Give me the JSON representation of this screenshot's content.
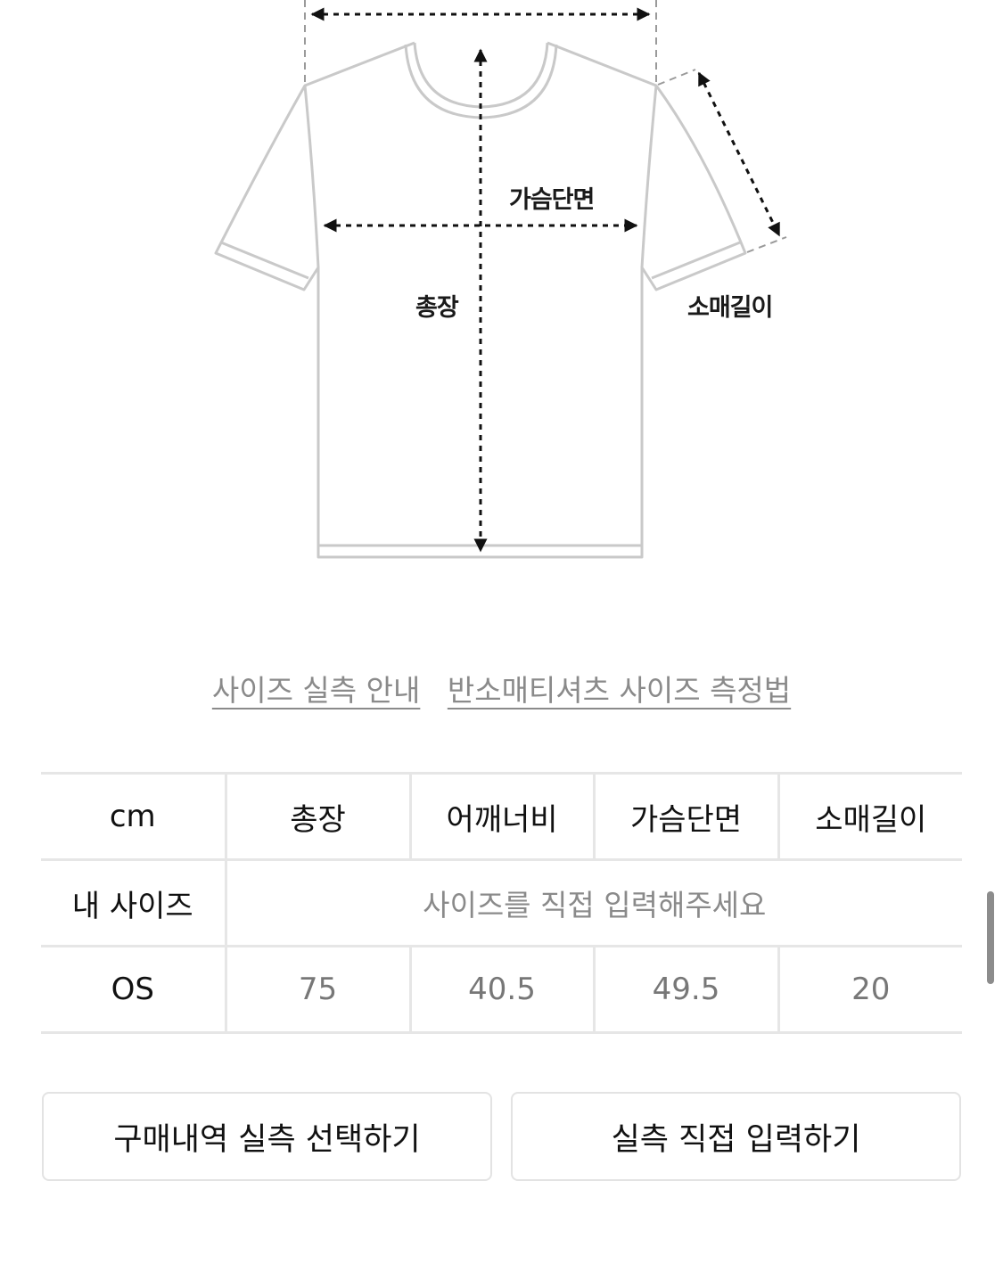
{
  "diagram": {
    "labels": {
      "chest": "가슴단면",
      "length": "총장",
      "sleeve": "소매길이"
    }
  },
  "links": {
    "size_guide": "사이즈 실측 안내",
    "measure_method": "반소매티셔츠 사이즈 측정법"
  },
  "table": {
    "unit": "cm",
    "columns": [
      "총장",
      "어깨너비",
      "가슴단면",
      "소매길이"
    ],
    "my_size_label": "내 사이즈",
    "my_size_placeholder": "사이즈를 직접 입력해주세요",
    "rows": [
      {
        "size": "OS",
        "values": [
          "75",
          "40.5",
          "49.5",
          "20"
        ]
      }
    ]
  },
  "buttons": {
    "select_history": "구매내역 실측 선택하기",
    "direct_input": "실측 직접 입력하기"
  }
}
